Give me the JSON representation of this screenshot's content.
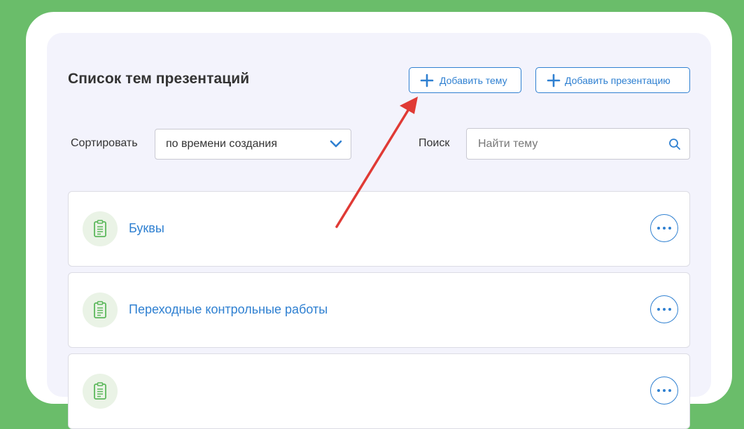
{
  "header": {
    "title": "Список тем презентаций",
    "add_topic_label": "Добавить тему",
    "add_presentation_label": "Добавить презентацию"
  },
  "filters": {
    "sort_label": "Сортировать",
    "sort_value": "по времени создания",
    "search_label": "Поиск",
    "search_placeholder": "Найти тему"
  },
  "topics": [
    {
      "title": "Буквы",
      "icon": "document-icon"
    },
    {
      "title": "Переходные контрольные работы",
      "icon": "document-icon"
    },
    {
      "title": "",
      "icon": "document-icon"
    }
  ],
  "colors": {
    "background": "#6abd6a",
    "accent": "#2f80d1",
    "panel": "#f3f3fc",
    "annotation_arrow": "#e03a35"
  }
}
